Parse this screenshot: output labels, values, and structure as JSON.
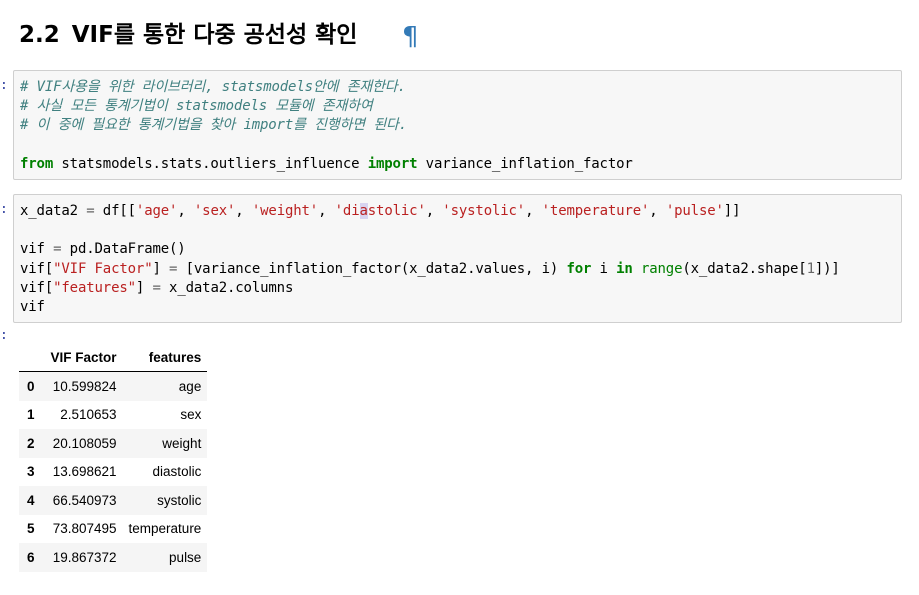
{
  "heading": {
    "number": "2.2",
    "title": "VIF를 통한 다중 공선성 확인",
    "anchor": "¶"
  },
  "cells": [
    {
      "prompt": ":",
      "comment1": "# VIF사용을 위한 라이브러리, statsmodels안에 존재한다.",
      "comment2": "# 사실 모든 통계기법이 statsmodels 모듈에 존재하여",
      "comment3": "# 이 중에 필요한 통계기법을 찾아 import를 진행하면 된다.",
      "kw_from": "from",
      "module": " statsmodels.stats.outliers_influence ",
      "kw_import": "import",
      "name": " variance_inflation_factor"
    },
    {
      "prompt": ":",
      "l1_a": "x_data2 ",
      "l1_eq": "=",
      "l1_b": " df[[",
      "s_age": "'age'",
      "comma": ", ",
      "s_sex": "'sex'",
      "s_weight": "'weight'",
      "s_dia_a": "'di",
      "s_dia_cur": "a",
      "s_dia_b": "stolic'",
      "s_systolic": "'systolic'",
      "s_temperature": "'temperature'",
      "s_pulse": "'pulse'",
      "l1_end": "]]",
      "l3_a": "vif ",
      "l3_eq": "=",
      "l3_b": " pd.DataFrame()",
      "l4_a": "vif[",
      "s_viffactor": "\"VIF Factor\"",
      "l4_b": "] ",
      "l4_eq": "=",
      "l4_c": " [variance_inflation_factor(x_data2.values, i) ",
      "kw_for": "for",
      "l4_d": " i ",
      "kw_in": "in",
      "l4_sp": " ",
      "bi_range": "range",
      "l4_e": "(x_data2.shape[",
      "n_one": "1",
      "l4_f": "])]",
      "l5_a": "vif[",
      "s_features": "\"features\"",
      "l5_b": "] ",
      "l5_eq": "=",
      "l5_c": " x_data2.columns",
      "l6": "vif"
    }
  ],
  "output_prompt": ":",
  "table": {
    "index_header": "",
    "columns": [
      "VIF Factor",
      "features"
    ],
    "rows": [
      {
        "index": "0",
        "vif": "10.599824",
        "feature": "age"
      },
      {
        "index": "1",
        "vif": "2.510653",
        "feature": "sex"
      },
      {
        "index": "2",
        "vif": "20.108059",
        "feature": "weight"
      },
      {
        "index": "3",
        "vif": "13.698621",
        "feature": "diastolic"
      },
      {
        "index": "4",
        "vif": "66.540973",
        "feature": "systolic"
      },
      {
        "index": "5",
        "vif": "73.807495",
        "feature": "temperature"
      },
      {
        "index": "6",
        "vif": "19.867372",
        "feature": "pulse"
      }
    ]
  }
}
